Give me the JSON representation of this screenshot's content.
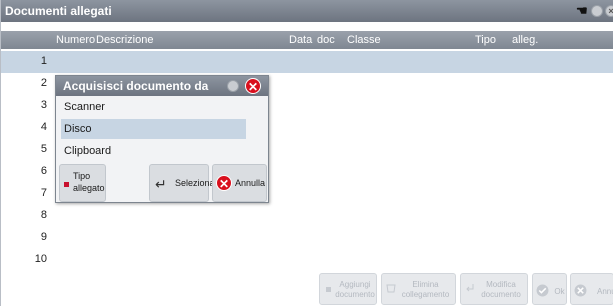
{
  "window": {
    "title": "Documenti allegati"
  },
  "table": {
    "columns": [
      "Numero",
      "Descrizione",
      "Data",
      "doc",
      "Classe",
      "Tipo",
      "alleg."
    ],
    "rows": [
      "1",
      "2",
      "3",
      "4",
      "5",
      "6",
      "7",
      "8",
      "9",
      "10"
    ],
    "selected_row": "1"
  },
  "dialog": {
    "title": "Acquisisci documento da",
    "options": [
      "Scanner",
      "Disco",
      "Clipboard"
    ],
    "selected_option": "Disco",
    "tipo_allegato_line1": "Tipo",
    "tipo_allegato_line2": "allegato",
    "seleziona_label": "Seleziona",
    "annulla_label": "Annulla"
  },
  "bottom_toolbar": {
    "aggiungi_line1": "Aggiungi",
    "aggiungi_line2": "documento",
    "elimina_line1": "Elimina",
    "elimina_line2": "collegamento",
    "modifica_line1": "Modifica",
    "modifica_line2": "documento",
    "ok_label": "Ok",
    "annulla_label": "Annulla"
  },
  "colors": {
    "titlebar": "#6d7480",
    "selection": "#c7d5e3",
    "cancel_red": "#d9101e",
    "tipo_marker": "#c8102e"
  },
  "icons": {
    "window_pin": "pin-icon",
    "window_restore": "circle-icon",
    "window_close": "close-icon",
    "dialog_close": "red-x-icon",
    "seleziona": "enter-arrow-icon",
    "annulla": "red-x-icon"
  }
}
